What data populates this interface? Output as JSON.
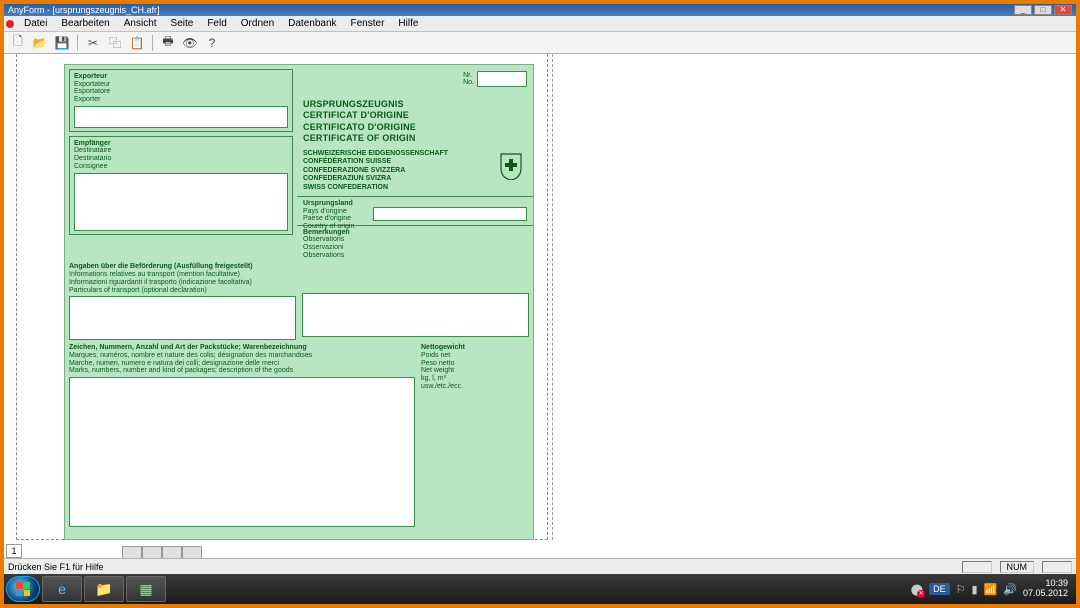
{
  "window": {
    "title": "AnyForm - [ursprungszeugnis_CH.afr]"
  },
  "menu": {
    "items": [
      "Datei",
      "Bearbeiten",
      "Ansicht",
      "Seite",
      "Feld",
      "Ordnen",
      "Datenbank",
      "Fenster",
      "Hilfe"
    ]
  },
  "toolbar": {
    "new": "new",
    "open": "open",
    "save": "save",
    "cut": "cut",
    "copy": "copy",
    "paste": "paste",
    "print": "print",
    "preview": "preview",
    "help": "help"
  },
  "form": {
    "exporter": {
      "label_de": "Exporteur",
      "label_fr": "Exportateur",
      "label_it": "Esportatore",
      "label_en": "Exporter"
    },
    "nr": {
      "label_de": "Nr.",
      "label_en": "No."
    },
    "consignee": {
      "label_de": "Empfänger",
      "label_fr": "Destinataire",
      "label_it": "Destinatario",
      "label_en": "Consignee"
    },
    "title": {
      "de": "URSPRUNGSZEUGNIS",
      "fr": "CERTIFICAT D'ORIGINE",
      "it": "CERTIFICATO D'ORIGINE",
      "en": "CERTIFICATE OF ORIGIN"
    },
    "confed": {
      "de": "SCHWEIZERISCHE EIDGENOSSENSCHAFT",
      "fr": "CONFÉDÉRATION SUISSE",
      "it": "CONFEDERAZIONE SVIZZERA",
      "rm": "CONFEDERAZIUN SVIZRA",
      "en": "SWISS CONFEDERATION"
    },
    "origin": {
      "label_de": "Ursprungsland",
      "label_fr": "Pays d'origine",
      "label_it": "Paese d'origine",
      "label_en": "Country of origin"
    },
    "remarks": {
      "label_de": "Bemerkungen",
      "label_fr": "Observations",
      "label_it": "Osservazioni",
      "label_en": "Observations"
    },
    "transport": {
      "label_de": "Angaben über die Beförderung (Ausfüllung freigestellt)",
      "label_fr": "Informations relatives au transport (mention facultative)",
      "label_it": "Informazioni riguardanti il trasporto (indicazione facoltativa)",
      "label_en": "Particulars of transport (optional declaration)"
    },
    "goods": {
      "label_de": "Zeichen, Nummern, Anzahl und Art der Packstücke; Warenbezeichnung",
      "label_fr": "Marques, numéros, nombre et nature des colis; désignation des marchandises",
      "label_it": "Marche, numeri, numero e natura dei colli; designazione delle merci",
      "label_en": "Marks, numbers, number and kind of packages; description of the goods"
    },
    "netweight": {
      "label_de": "Nettogewicht",
      "label_fr": "Poids net",
      "label_it": "Peso netto",
      "label_en": "Net weight",
      "unit1": "kg, l, m³",
      "unit2": "usw./etc./ecc."
    }
  },
  "page_number": "1",
  "statusbar": {
    "hint": "Drücken Sie F1 für Hilfe",
    "num": "NUM"
  },
  "taskbar": {
    "lang": "DE",
    "time": "10:39",
    "date": "07.05.2012"
  }
}
